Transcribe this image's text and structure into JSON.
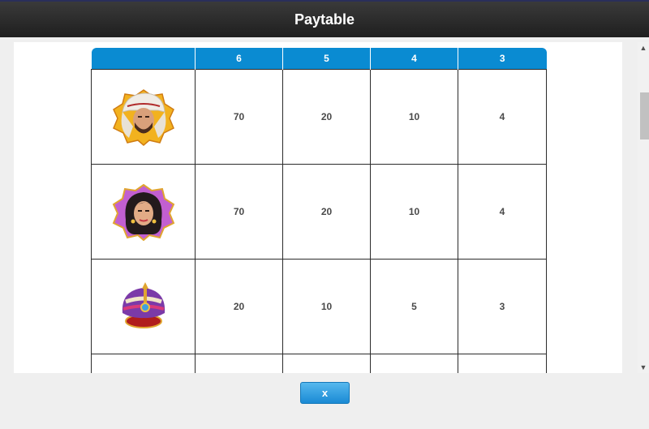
{
  "header": {
    "title": "Paytable"
  },
  "table": {
    "columns": [
      "",
      "6",
      "5",
      "4",
      "3"
    ],
    "rows": [
      {
        "symbol": "sheikh-symbol-icon",
        "values": [
          "70",
          "20",
          "10",
          "4"
        ]
      },
      {
        "symbol": "princess-symbol-icon",
        "values": [
          "70",
          "20",
          "10",
          "4"
        ]
      },
      {
        "symbol": "turban-symbol-icon",
        "values": [
          "20",
          "10",
          "5",
          "3"
        ]
      }
    ]
  },
  "footer": {
    "close_label": "x"
  },
  "colors": {
    "header_bg": "#2a2a2a",
    "accent": "#0a8bd2"
  }
}
